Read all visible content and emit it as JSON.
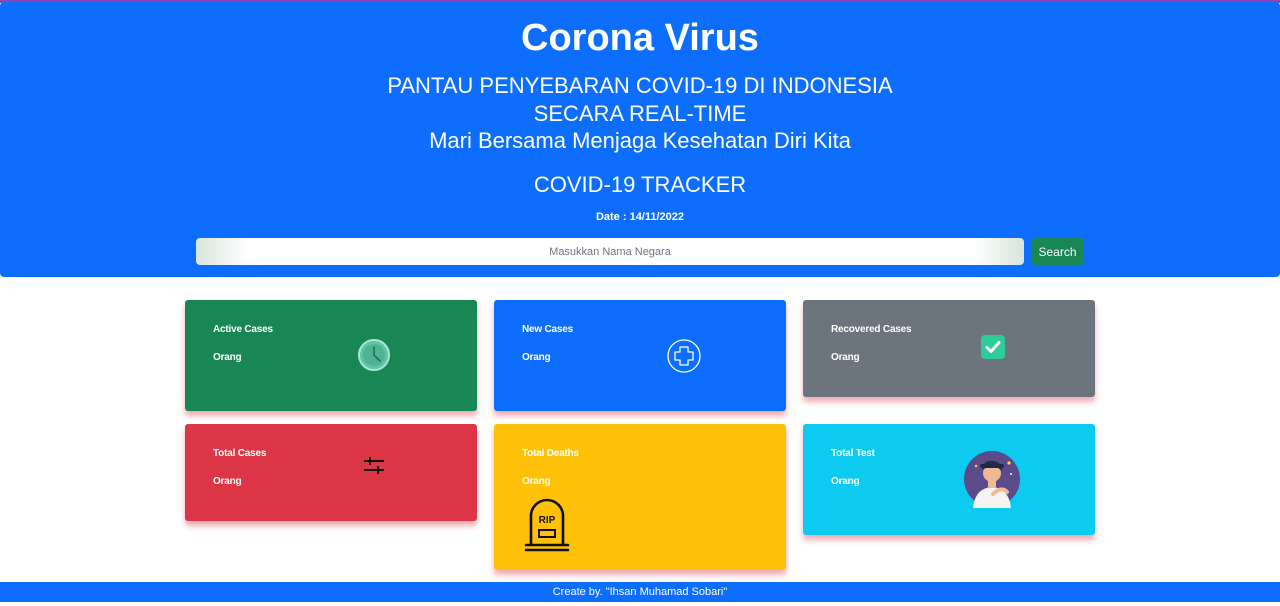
{
  "header": {
    "title": "Corona Virus",
    "subtitle_line1": "PANTAU PENYEBARAN COVID-19 DI INDONESIA",
    "subtitle_line2": "SECARA REAL-TIME",
    "subtitle_line3": "Mari Bersama Menjaga Kesehatan Diri Kita",
    "tracker_title": "COVID-19 TRACKER",
    "date": "Date : 14/11/2022"
  },
  "search": {
    "placeholder": "Masukkan Nama Negara",
    "value": "",
    "button_label": "Search"
  },
  "cards": [
    {
      "label": "Active Cases",
      "unit": "Orang",
      "icon": "clock-icon",
      "color": "#198754"
    },
    {
      "label": "New Cases",
      "unit": "Orang",
      "icon": "plus-circle-icon",
      "color": "#0d6efd"
    },
    {
      "label": "Recovered Cases",
      "unit": "Orang",
      "icon": "check-square-icon",
      "color": "#6c757d"
    },
    {
      "label": "Total Cases",
      "unit": "Orang",
      "icon": "sliders-icon",
      "color": "#dc3545"
    },
    {
      "label": "Total Deaths",
      "unit": "Orang",
      "icon": "tombstone-icon",
      "color": "#ffc107"
    },
    {
      "label": "Total Test",
      "unit": "Orang",
      "icon": "sick-person-icon",
      "color": "#0dcaf0"
    }
  ],
  "footer": {
    "text": "Create by. \"Ihsan Muhamad Sobari\""
  }
}
